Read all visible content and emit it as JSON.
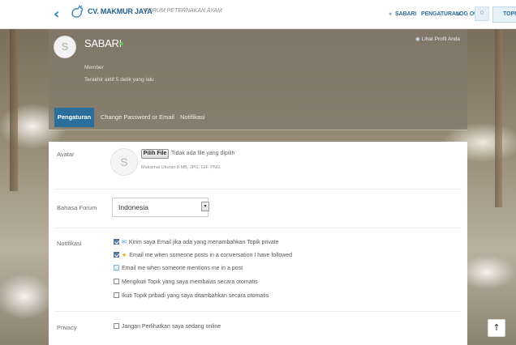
{
  "header": {
    "brand": "CV. MAKMUR JAYA",
    "tagline": "FORUM PETERNAKAN AYAM",
    "nav": {
      "user": "SABARI",
      "settings": "PENGATURAN",
      "logout": "LOG OUT"
    },
    "notification_count": "0",
    "new_topic": "TOPIK BARU"
  },
  "profile": {
    "initial": "S",
    "name": "SABARI",
    "view_profile": "Lihat Profil Anda",
    "role": "Member",
    "status": "Terakhir aktif 5 detik yang lalu"
  },
  "tabs": [
    {
      "label": "Pengaturan",
      "active": true
    },
    {
      "label": "Change Password or Email",
      "active": false
    },
    {
      "label": "Notifikasi",
      "active": false
    }
  ],
  "settings": {
    "avatar": {
      "label": "Avatar",
      "initial": "S",
      "choose_file": "Pilih File",
      "file_status": "Tidak ada file yang dipilih",
      "hint": "Maksimal Ukuran 8 MB, JPG, GIF, PNG."
    },
    "language": {
      "label": "Bahasa Forum",
      "value": "Indonesia"
    },
    "notifications": {
      "label": "Notifikasi",
      "items": [
        {
          "text": "Kirim saya Email jika ada yang menambahkan Topik private",
          "checked": true,
          "icon": "mail-icon"
        },
        {
          "text": "Email me when someone posts in a conversation I have followed",
          "checked": true,
          "icon": "star-icon"
        },
        {
          "text": "Email me when someone mentions me in a post",
          "checked": false,
          "icon": null
        },
        {
          "text": "Mengikuti Topik yang saya membalas secara otomatis",
          "checked": false,
          "icon": null
        },
        {
          "text": "Ikuti Topik pribadi yang saya ditambahkan secara otomatis",
          "checked": false,
          "icon": null
        }
      ]
    },
    "privacy": {
      "label": "Privacy",
      "option": "Jangan Perlihatkan saya sedang online",
      "checked": false
    }
  },
  "colors": {
    "accent": "#2a6f9c",
    "link": "#2d6f9e",
    "online": "#56c14a"
  }
}
